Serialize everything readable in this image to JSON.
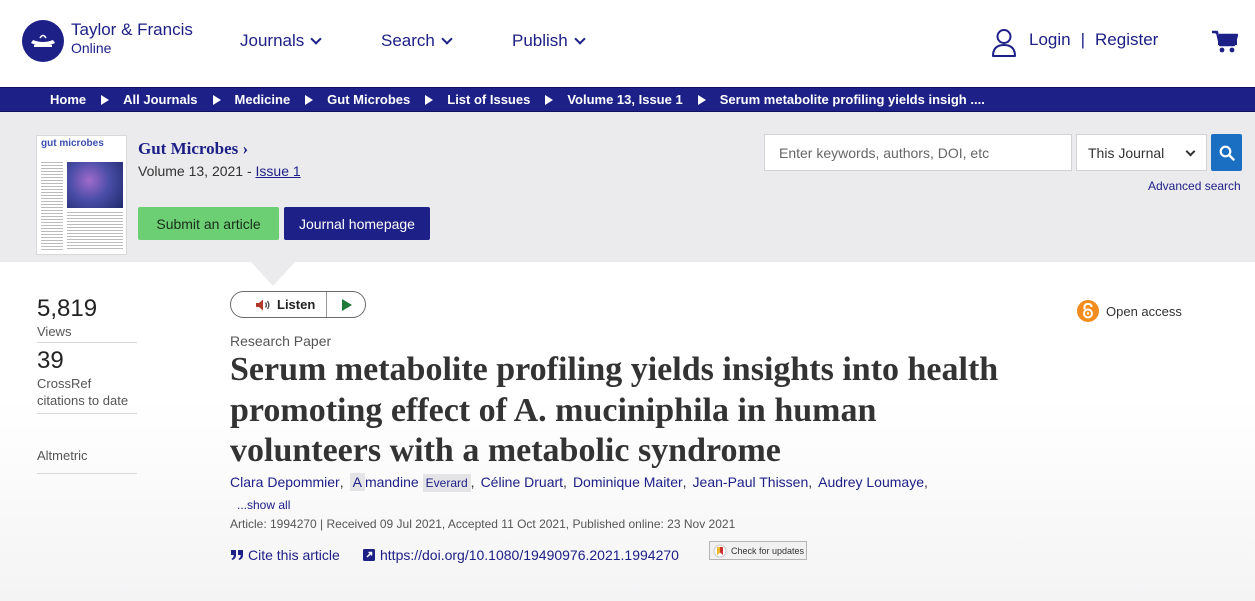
{
  "header": {
    "logo_line1": "Taylor & Francis",
    "logo_line2": "Online",
    "nav": [
      "Journals",
      "Search",
      "Publish"
    ],
    "login_label": "Login",
    "separator": "|",
    "register_label": "Register"
  },
  "breadcrumb": [
    "Home",
    "All Journals",
    "Medicine",
    "Gut Microbes",
    "List of Issues",
    "Volume 13, Issue 1",
    "Serum metabolite profiling yields insigh ...."
  ],
  "journal": {
    "cover_title": "gut microbes",
    "name": "Gut Microbes",
    "name_arrow": "›",
    "volume_text": "Volume 13, 2021 - ",
    "issue_link": "Issue 1",
    "submit_label": "Submit an article",
    "homepage_label": "Journal homepage"
  },
  "search": {
    "placeholder": "Enter keywords, authors, DOI, etc",
    "scope_selected": "This Journal",
    "advanced_label": "Advanced search"
  },
  "metrics": {
    "views_value": "5,819",
    "views_label": "Views",
    "citations_value": "39",
    "citations_label_1": "CrossRef",
    "citations_label_2": "citations to date",
    "altmetric_label": "Altmetric"
  },
  "listen_label": "Listen",
  "article": {
    "type": "Research Paper",
    "title": "Serum metabolite profiling yields insights into health promoting effect of A. muciniphila in human volunteers with a metabolic syndrome",
    "open_access_label": "Open access",
    "authors": {
      "a1": "Clara Depommier",
      "a2_first_letter": "A",
      "a2_rest": "mandine",
      "a2_last": "Everard",
      "a3": "Céline Druart",
      "a4": "Dominique Maiter",
      "a5": "Jean-Paul Thissen",
      "a6": "Audrey Loumaye",
      "comma": ","
    },
    "show_all": "...show all",
    "meta": "Article: 1994270 | Received 09 Jul 2021, Accepted 11 Oct 2021, Published online: 23 Nov 2021",
    "cite_label": "Cite this article",
    "doi_link": "https://doi.org/10.1080/19490976.2021.1994270",
    "check_updates_label": "Check for updates"
  },
  "colors": {
    "brand_navy": "#1d2087",
    "submit_green": "#6ccf74",
    "search_blue": "#1a6fc2",
    "open_access_orange": "#f28c1e"
  }
}
